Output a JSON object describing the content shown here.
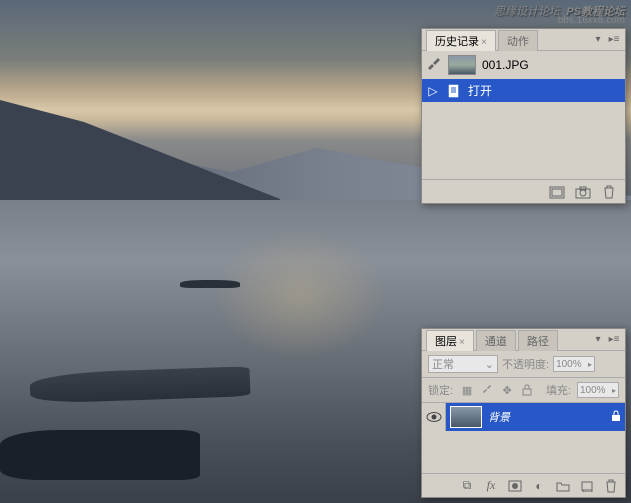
{
  "watermark": {
    "line1": "思缘设计论坛",
    "line2": "PS教程论坛",
    "line3": "bbs.16xx8.com"
  },
  "history": {
    "tab_history": "历史记录",
    "tab_actions": "动作",
    "source_name": "001.JPG",
    "items": [
      {
        "label": "打开",
        "selected": true
      }
    ]
  },
  "layers": {
    "tab_layers": "图层",
    "tab_channels": "通道",
    "tab_paths": "路径",
    "blend_mode": "正常",
    "opacity_label": "不透明度:",
    "opacity_value": "100%",
    "lock_label": "锁定:",
    "fill_label": "填充:",
    "fill_value": "100%",
    "rows": [
      {
        "name": "背景",
        "selected": true,
        "locked": true
      }
    ]
  }
}
